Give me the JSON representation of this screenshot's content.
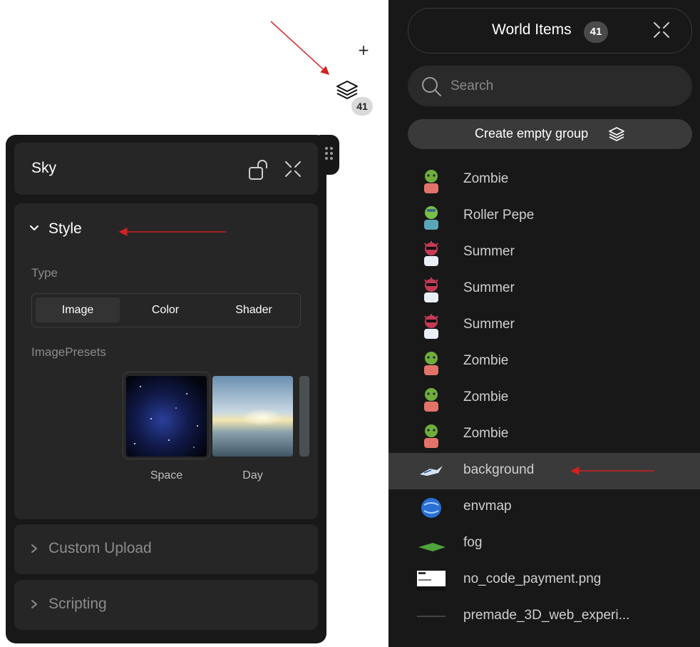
{
  "floating": {
    "plus": "+",
    "layers_count": "41"
  },
  "sky_panel": {
    "title": "Sky",
    "style_section": {
      "title": "Style",
      "type_label": "Type",
      "type_options": [
        "Image",
        "Color",
        "Shader"
      ],
      "type_selected": "Image",
      "presets_label": "ImagePresets",
      "presets": [
        "Space",
        "Day"
      ]
    },
    "sections": [
      "Custom Upload",
      "Scripting"
    ]
  },
  "world_items": {
    "title": "World Items",
    "count": "41",
    "search_placeholder": "Search",
    "create_group_label": "Create empty group",
    "items": [
      {
        "label": "Zombie",
        "icon": "zombie-avatar-icon"
      },
      {
        "label": "Roller Pepe",
        "icon": "roller-pepe-avatar-icon"
      },
      {
        "label": "Summer",
        "icon": "summer-avatar-icon"
      },
      {
        "label": "Summer",
        "icon": "summer-avatar-icon"
      },
      {
        "label": "Summer",
        "icon": "summer-avatar-icon"
      },
      {
        "label": "Zombie",
        "icon": "zombie-avatar-icon"
      },
      {
        "label": "Zombie",
        "icon": "zombie-avatar-icon"
      },
      {
        "label": "Zombie",
        "icon": "zombie-avatar-icon"
      },
      {
        "label": "background",
        "icon": "background-thumb-icon",
        "selected": true
      },
      {
        "label": "envmap",
        "icon": "envmap-sphere-icon"
      },
      {
        "label": "fog",
        "icon": "fog-plane-icon"
      },
      {
        "label": "no_code_payment.png",
        "icon": "image-file-thumb-icon"
      },
      {
        "label": "premade_3D_web_experi...",
        "icon": "file-thumb-icon"
      }
    ]
  },
  "colors": {
    "panel_bg": "#181818",
    "card_bg": "#262626",
    "selected_row": "#3a3a3a",
    "annotation_arrow": "#d32020"
  }
}
